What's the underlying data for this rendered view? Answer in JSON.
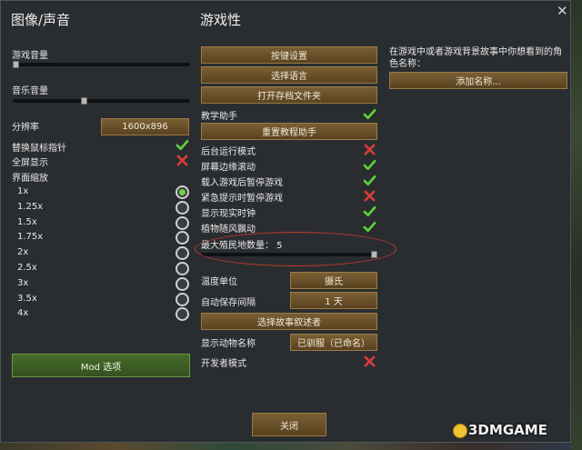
{
  "graphics_audio": {
    "title": "图像/声音",
    "game_volume_label": "游戏音量",
    "game_volume_level": 0.0,
    "music_volume_label": "音乐音量",
    "music_volume_level": 0.4,
    "resolution_label": "分辨率",
    "resolution_value": "1600x896",
    "custom_cursor_label": "替换鼠标指针",
    "custom_cursor_on": true,
    "fullscreen_label": "全屏显示",
    "fullscreen_on": false,
    "ui_scale_label": "界面缩放",
    "ui_scale_options": [
      "1x",
      "1.25x",
      "1.5x",
      "1.75x",
      "2x",
      "2.5x",
      "3x",
      "3.5x",
      "4x"
    ],
    "ui_scale_selected": "1x",
    "mod_button": "Mod 选项"
  },
  "gameplay": {
    "title": "游戏性",
    "keybinds_button": "按键设置",
    "language_button": "选择语言",
    "open_save_folder_button": "打开存档文件夹",
    "tutor_label": "教学助手",
    "tutor_on": true,
    "reset_tutor_button": "重置教程助手",
    "toggles": [
      {
        "label": "后台运行模式",
        "on": false
      },
      {
        "label": "屏幕边缘滚动",
        "on": true
      },
      {
        "label": "载入游戏后暂停游戏",
        "on": true
      },
      {
        "label": "紧急提示时暂停游戏",
        "on": false
      },
      {
        "label": "显示现实时钟",
        "on": true
      },
      {
        "label": "植物随风飘动",
        "on": true
      }
    ],
    "max_colonies_label": "最大殖民地数量： 5",
    "max_colonies_level": 1.0,
    "temperature_label": "温度单位",
    "temperature_value": "摄氏",
    "autosave_label": "自动保存间隔",
    "autosave_value": "1 天",
    "storyteller_button": "选择故事叙述者",
    "animal_names_label": "显示动物名称",
    "animal_names_value": "已驯服（已命名）",
    "dev_mode_label": "开发者模式",
    "dev_mode_on": false
  },
  "names": {
    "description": "在游戏中或者游戏背景故事中你想看到的角色名称：",
    "add_name_button": "添加名称..."
  },
  "close_button": "关闭",
  "close_x": "✕",
  "watermark": "3DMGAME",
  "colors": {
    "check": "#5fd23a",
    "cross": "#d83b3b",
    "button_brown": "#6b4f28",
    "button_green": "#3e5f26",
    "highlight": "#c0392b"
  }
}
